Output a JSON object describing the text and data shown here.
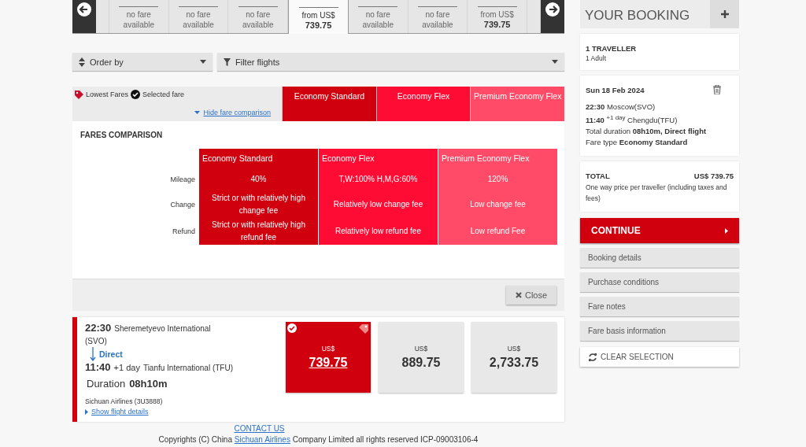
{
  "date_strip": [
    {
      "fare_line1": "no fare",
      "fare_line2": "available",
      "selected": false
    },
    {
      "fare_line1": "no fare",
      "fare_line2": "available",
      "selected": false
    },
    {
      "fare_line1": "no fare",
      "fare_line2": "available",
      "selected": false
    },
    {
      "fare_line1": "from US$",
      "fare_line2": "739.75",
      "selected": true
    },
    {
      "fare_line1": "no fare",
      "fare_line2": "available",
      "selected": false
    },
    {
      "fare_line1": "no fare",
      "fare_line2": "available",
      "selected": false
    },
    {
      "fare_line1": "from US$",
      "fare_line2": "739.75",
      "selected": false
    }
  ],
  "toolbar": {
    "order_by": "Order by",
    "filter": "Filter flights"
  },
  "legend": {
    "lowest": "Lowest Fares",
    "selected": "Selected fare",
    "toggle": "Hide fare comparison"
  },
  "fare_families": [
    {
      "name": "Economy Standard",
      "color": "#d0000f"
    },
    {
      "name": "Economy Flex",
      "color": "#ff0c35"
    },
    {
      "name": "Premium Economy Flex",
      "color": "#ff4b68"
    }
  ],
  "comparison": {
    "title": "FARES COMPARISON",
    "columns": [
      "Economy Standard",
      "Economy Flex",
      "Premium Economy Flex"
    ],
    "rows": [
      {
        "label": "Mileage",
        "values": [
          "40%",
          "T,W:100% H,M,G:60%",
          "120%"
        ]
      },
      {
        "label": "Change",
        "values": [
          "Strict or with relatively high change fee",
          "Relatively low change fee",
          "Low change fee"
        ]
      },
      {
        "label": "Refund",
        "values": [
          "Strict or with relatively high refund fee",
          "Relatively low refund fee",
          "Low refund Fee"
        ]
      }
    ],
    "close": "Close"
  },
  "flight": {
    "dep_time": "22:30",
    "dep_airport": "Sheremetyevo International",
    "dep_code": "(SVO)",
    "stops": "Direct",
    "arr_time": "11:40",
    "arr_offset": "+1 day",
    "arr_airport": "Tianfu International (TFU)",
    "duration_label": "Duration",
    "duration": "08h10m",
    "airline": "Sichuan Airlines (3U3888)",
    "details_link": "Show flight details",
    "fares": [
      {
        "currency": "US$",
        "price": "739.75",
        "selected": true,
        "lowest": true
      },
      {
        "currency": "US$",
        "price": "889.75",
        "selected": false,
        "lowest": false
      },
      {
        "currency": "US$",
        "price": "2,733.75",
        "selected": false,
        "lowest": false
      }
    ]
  },
  "footer": {
    "contact": "CONTACT US",
    "copyright_before": "Copyrights (C) China",
    "copyright_link": "Sichuan Airlines",
    "copyright_after": "Company Limited all rights reserved ICP-09003106-4"
  },
  "booking": {
    "title": "YOUR BOOKING",
    "travellers": "1 TRAVELLER",
    "travellers_detail": "1 Adult",
    "date": "Sun 18 Feb 2024",
    "lines": [
      "**22:30** Moscow(SVO)",
      "**11:40** $^{+1 day}$ Chengdu(TFU)",
      "Total duration **08h10m, Direct flight**",
      "Fare type **Economy Standard**"
    ],
    "total_label": "TOTAL",
    "total": "US$ 739.75",
    "total_note": "One way price per traveller (including taxes and fees)",
    "continue": "CONTINUE",
    "links": [
      "Booking details",
      "Purchase conditions",
      "Fare notes",
      "Fare basis information"
    ],
    "clear": "CLEAR SELECTION"
  }
}
